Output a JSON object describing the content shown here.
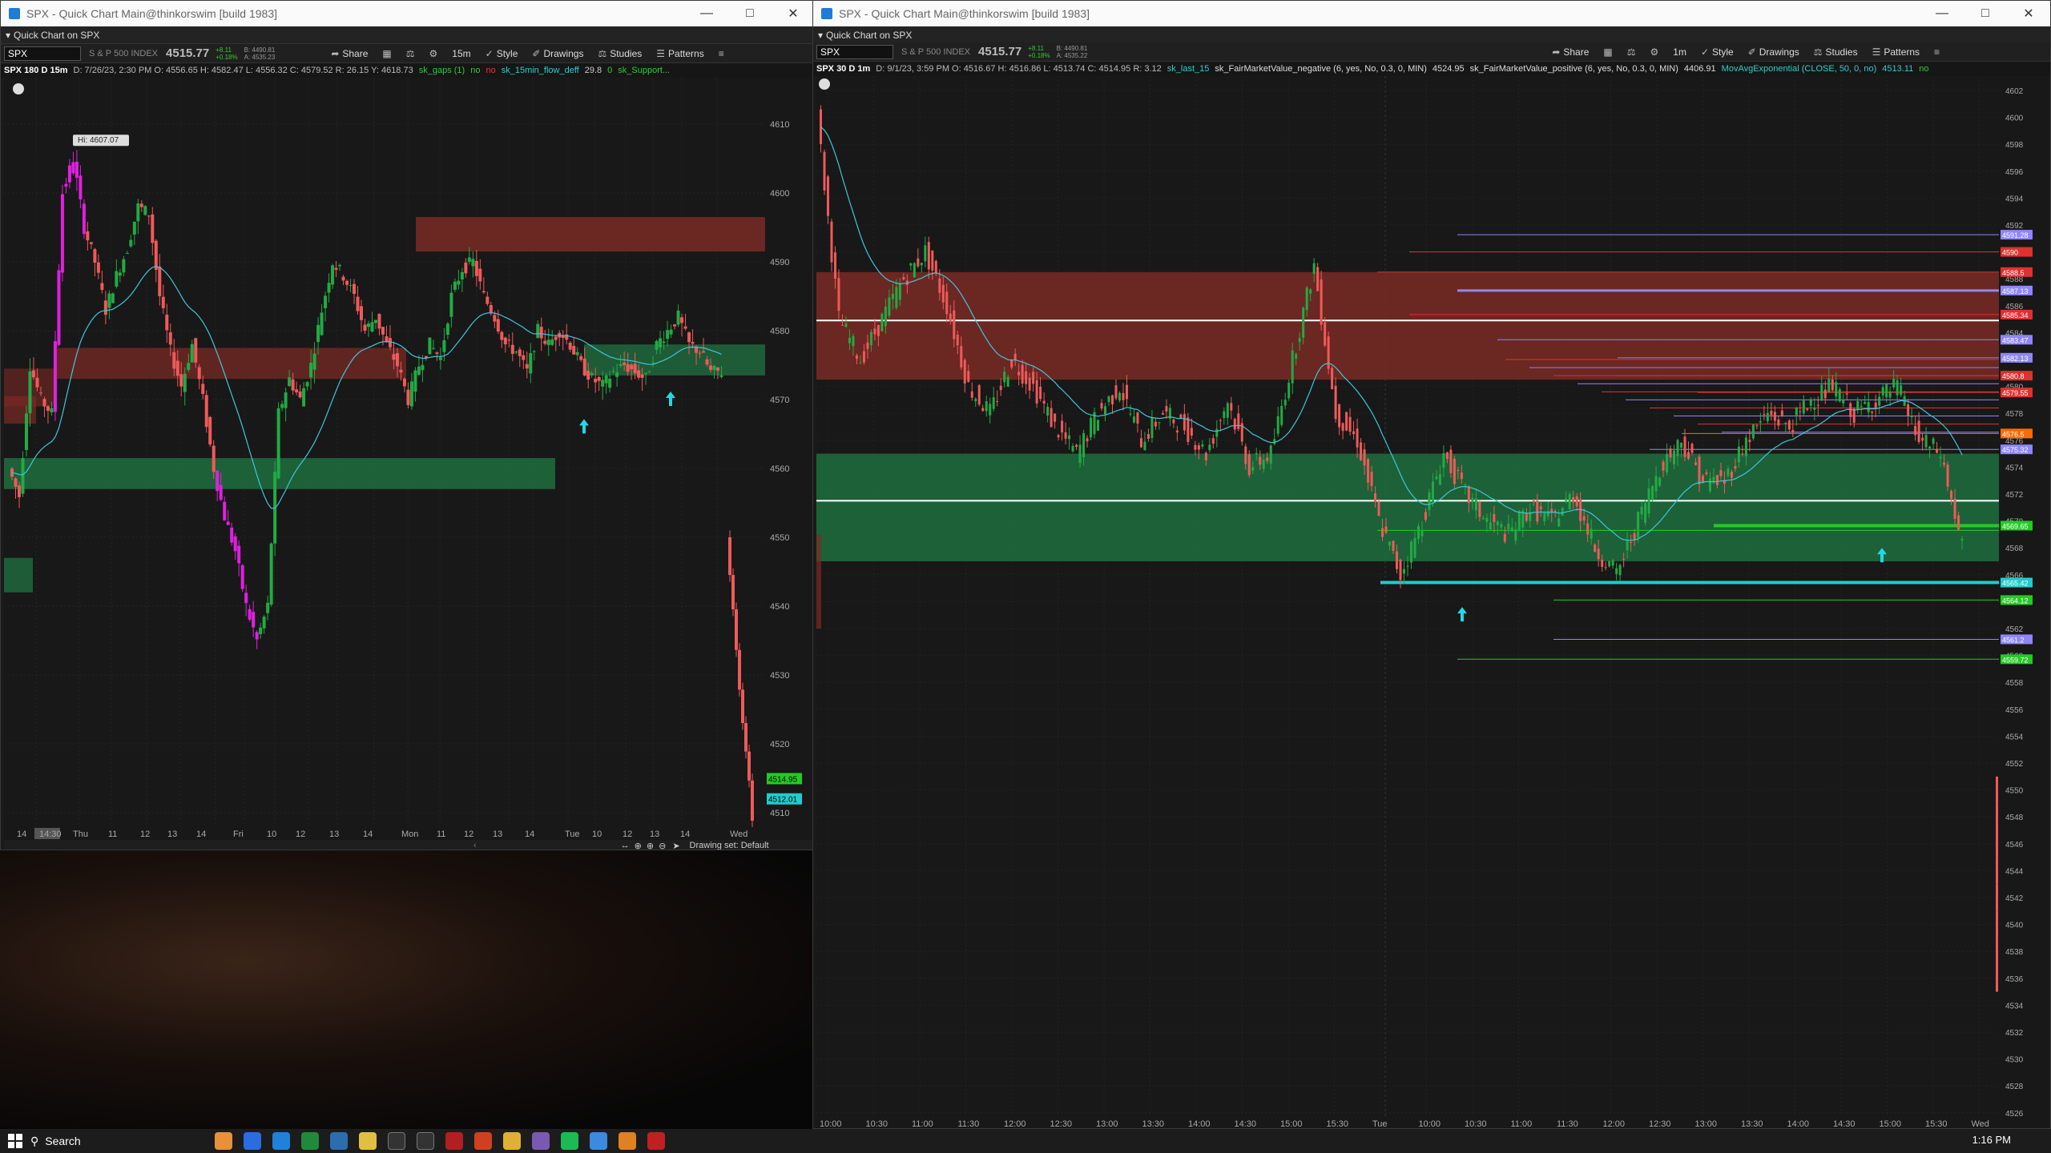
{
  "taskbar": {
    "search_label": "Search",
    "clock": "1:16 PM"
  },
  "left_window": {
    "title": "SPX - Quick Chart Main@thinkorswim [build 1983]",
    "subtitle": "Quick Chart on SPX",
    "toolbar": {
      "symbol": "SPX",
      "description": "S & P 500 INDEX",
      "price": "4515.77",
      "change_top": "+8.11",
      "change_bottom": "+0.18%",
      "bid": "B: 4490.81",
      "ask": "A: 4535.23",
      "timeframe": "15m",
      "share": "Share",
      "style": "Style",
      "drawings": "Drawings",
      "studies": "Studies",
      "patterns": "Patterns"
    },
    "studies": {
      "head": "SPX 180 D 15m",
      "ohlc": "D: 7/26/23, 2:30 PM  O: 4556.65  H: 4582.47  L: 4556.32  C: 4579.52  R: 26.15  Y: 4618.73",
      "s1": "sk_gaps (1)",
      "s1v": "no",
      "s1w": "no",
      "s2": "sk_15min_flow_deff",
      "s2v": "29.8",
      "s2w": "0",
      "s3": "sk_Support..."
    },
    "hi_label": "Hi: 4607.07",
    "price_ticks": [
      "4610",
      "4600",
      "4590",
      "4580",
      "4570",
      "4560",
      "4550",
      "4540",
      "4530",
      "4520",
      "4510"
    ],
    "price_badges": [
      "4514.95",
      "4512.01"
    ],
    "x_ticks": [
      "14",
      "14:30",
      "Thu",
      "11",
      "12",
      "13",
      "14",
      "Fri",
      "10",
      "12",
      "13",
      "14",
      "Mon",
      "11",
      "12",
      "13",
      "14",
      "Tue",
      "10",
      "12",
      "13",
      "14",
      "Wed"
    ],
    "drawing_set": "Drawing set: Default"
  },
  "right_window": {
    "title": "SPX - Quick Chart Main@thinkorswim [build 1983]",
    "subtitle": "Quick Chart on SPX",
    "toolbar": {
      "symbol": "SPX",
      "description": "S & P 500 INDEX",
      "price": "4515.77",
      "change_top": "+8.11",
      "change_bottom": "+0.18%",
      "bid": "B: 4490.81",
      "ask": "A: 4535.22",
      "timeframe": "1m",
      "share": "Share",
      "style": "Style",
      "drawings": "Drawings",
      "studies": "Studies",
      "patterns": "Patterns"
    },
    "studies": {
      "head": "SPX 30 D 1m",
      "ohlc": "D: 9/1/23, 3:59 PM  O: 4516.67  H: 4516.86  L: 4513.74  C: 4514.95  R: 3.12",
      "s1": "sk_last_15",
      "s2": "sk_FairMarketValue_negative (6, yes, No, 0.3, 0, MIN)",
      "s2v": "4524.95",
      "s3": "sk_FairMarketValue_positive (6, yes, No, 0.3, 0, MIN)",
      "s3v": "4406.91",
      "s4": "MovAvgExponential (CLOSE, 50, 0, no)",
      "s4v": "4513.11",
      "s5": "no"
    },
    "price_ticks": [
      "4602",
      "4600",
      "4598",
      "4596",
      "4594",
      "4592",
      "4590",
      "4588",
      "4586",
      "4584",
      "4582",
      "4580",
      "4578",
      "4576",
      "4574",
      "4572",
      "4570",
      "4568",
      "4566",
      "4564",
      "4562",
      "4560",
      "4558",
      "4556",
      "4554",
      "4552",
      "4550",
      "4548",
      "4546",
      "4544",
      "4542",
      "4540",
      "4538",
      "4536",
      "4534",
      "4532",
      "4530",
      "4528",
      "4526"
    ],
    "price_badges": [
      {
        "v": "4591.28",
        "c": "#8f86ff"
      },
      {
        "v": "4590",
        "c": "#e03030"
      },
      {
        "v": "4588.5",
        "c": "#e03030"
      },
      {
        "v": "4587.13",
        "c": "#8f86ff"
      },
      {
        "v": "4585.34",
        "c": "#e03030"
      },
      {
        "v": "4583.47",
        "c": "#8f86ff"
      },
      {
        "v": "4582.13",
        "c": "#8f86ff"
      },
      {
        "v": "4580.8",
        "c": "#e03030"
      },
      {
        "v": "4579.55",
        "c": "#e03030"
      },
      {
        "v": "4576.5",
        "c": "#ff6a00"
      },
      {
        "v": "4575.32",
        "c": "#8f86ff"
      },
      {
        "v": "4569.65",
        "c": "#22cc22"
      },
      {
        "v": "4565.42",
        "c": "#22cccc"
      },
      {
        "v": "4564.12",
        "c": "#22cc22"
      },
      {
        "v": "4561.2",
        "c": "#8f86ff"
      },
      {
        "v": "4559.72",
        "c": "#22cc22"
      }
    ],
    "x_ticks": [
      "10:00",
      "10:30",
      "11:00",
      "11:30",
      "12:00",
      "12:30",
      "13:00",
      "13:30",
      "14:00",
      "14:30",
      "15:00",
      "15:30",
      "Tue",
      "10:00",
      "10:30",
      "11:00",
      "11:30",
      "12:00",
      "12:30",
      "13:00",
      "13:30",
      "14:00",
      "14:30",
      "15:00",
      "15:30",
      "Wed"
    ]
  },
  "colors": {
    "up": "#22aa44",
    "down": "#ef5a5a",
    "ema": "#3fc6d8",
    "supply": "#7a2a24",
    "demand": "#1f6e3e",
    "magenta": "#e020e0"
  }
}
